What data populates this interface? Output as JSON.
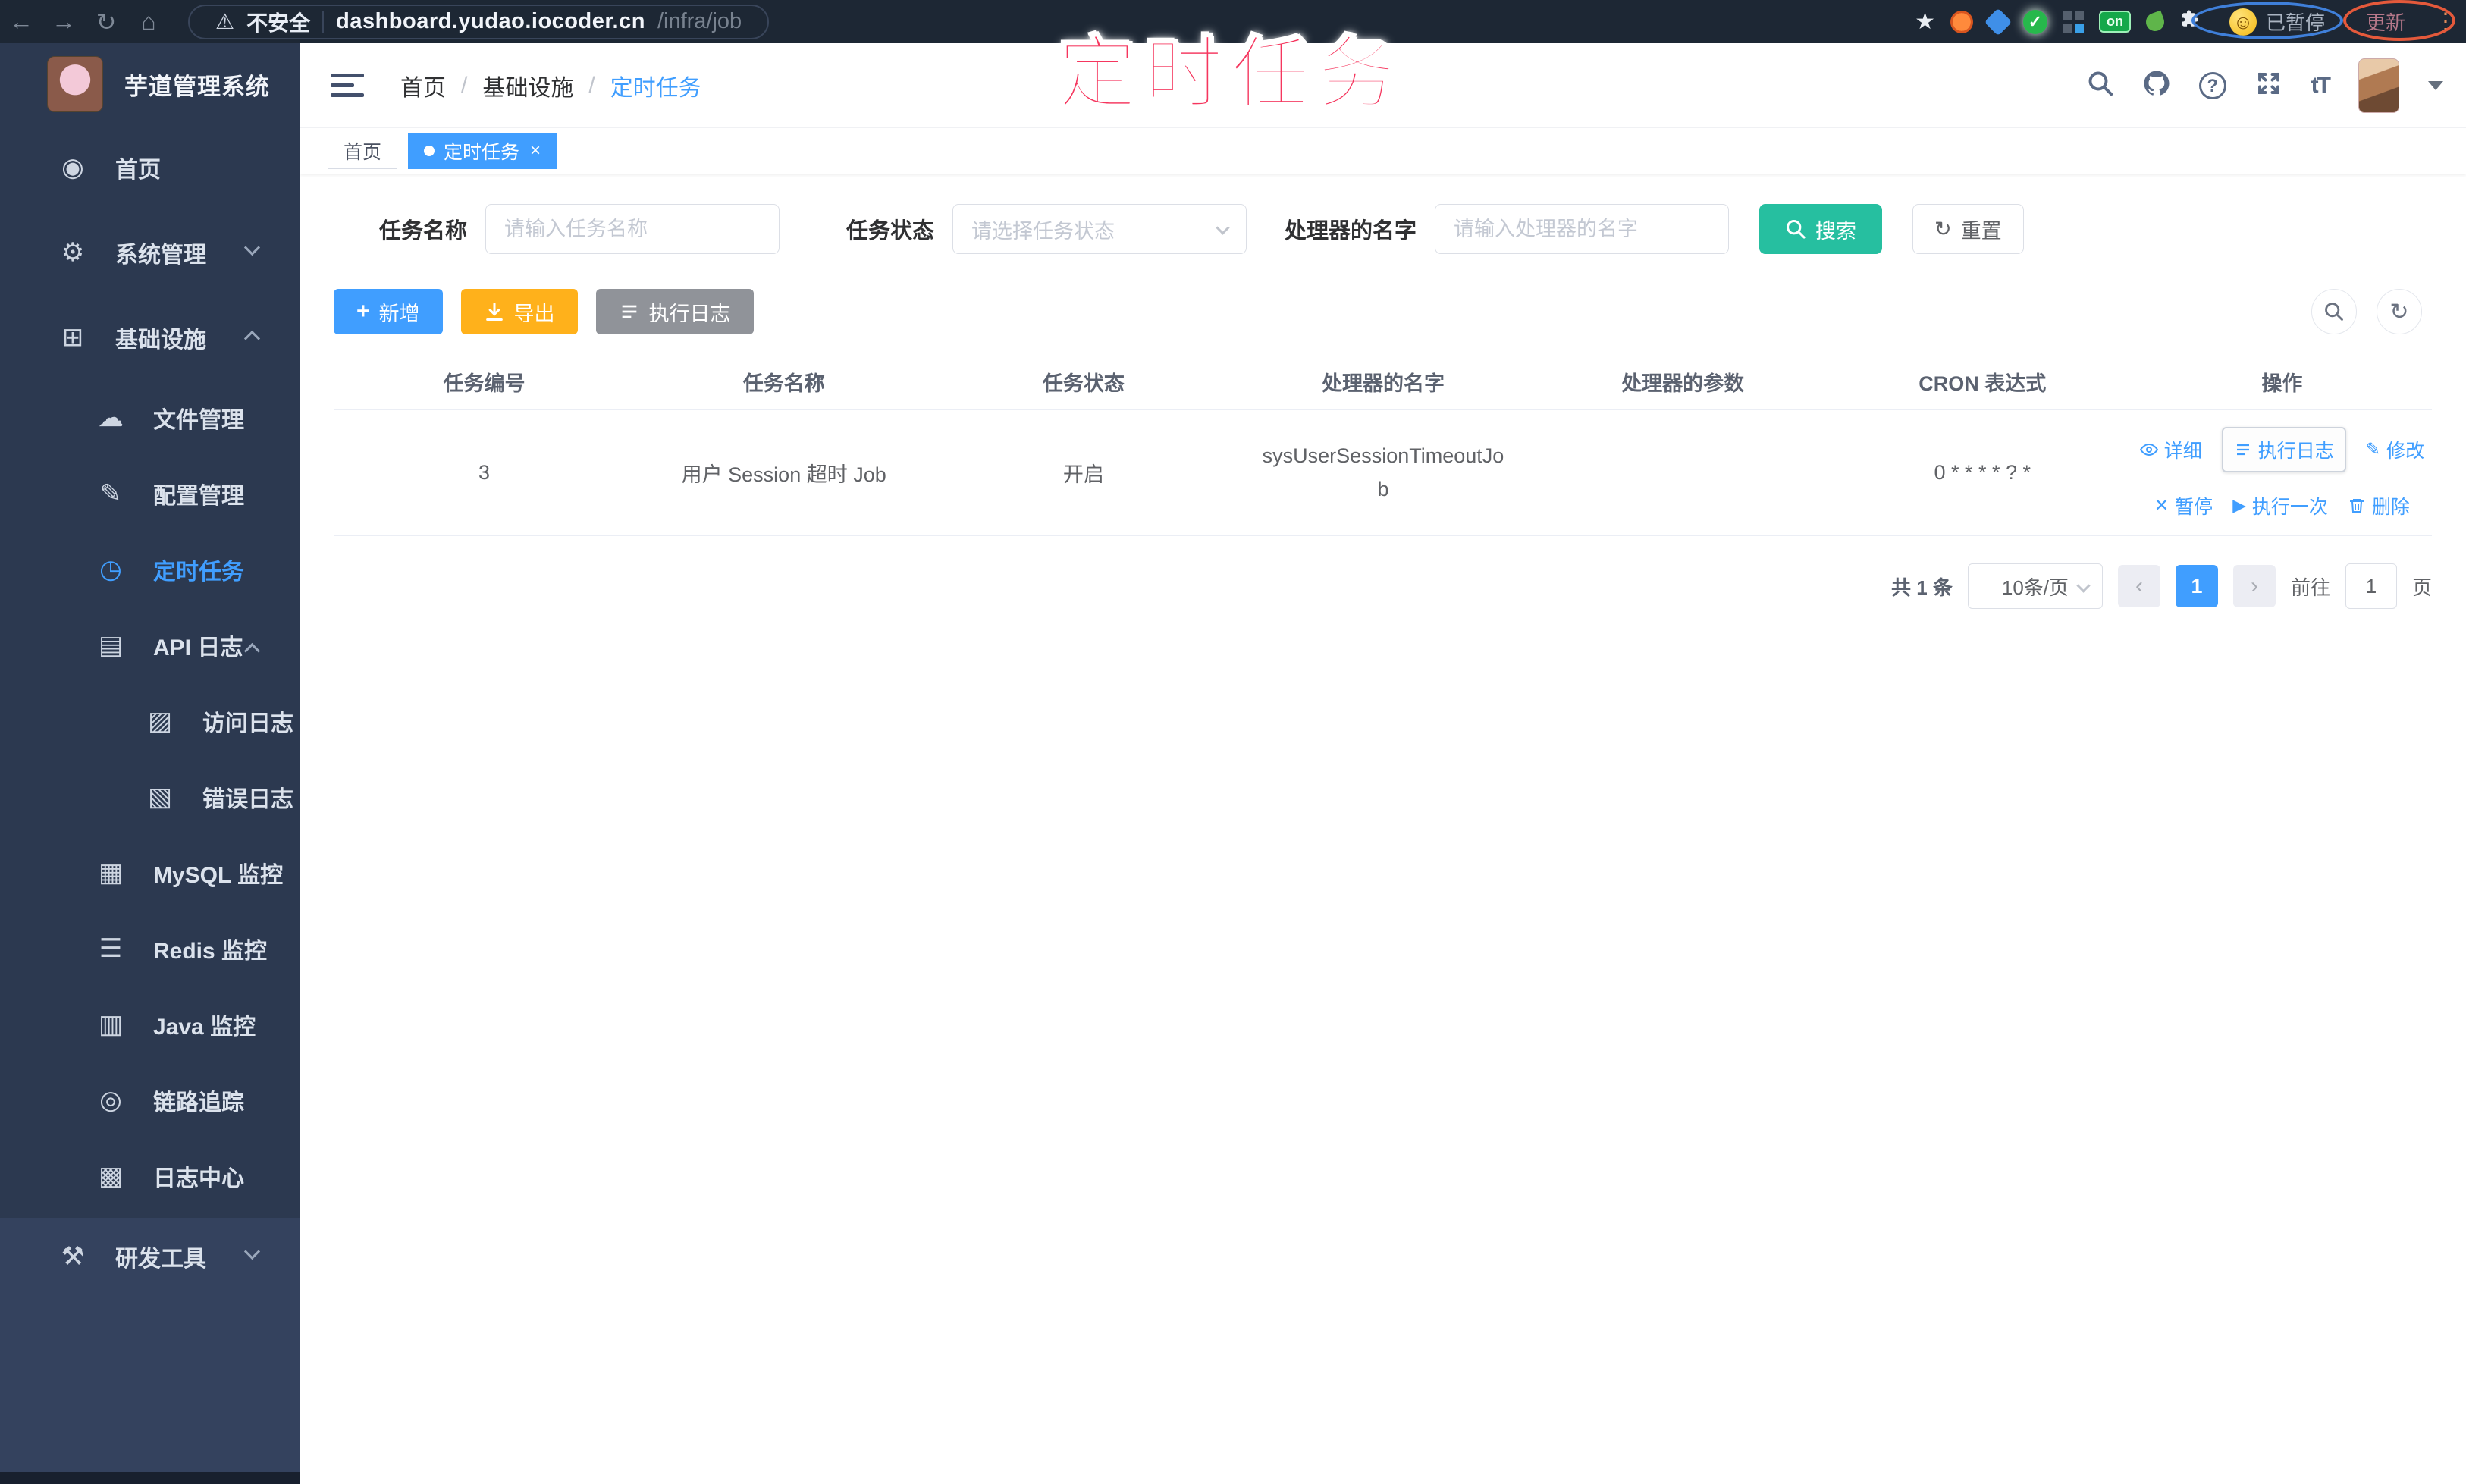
{
  "colors": {
    "primary": "#409eff",
    "search_teal": "#26bfa0",
    "export_orange": "#ffb11b",
    "info_gray": "#909399",
    "sidebar_bg": "#2c3950",
    "annotation_pink": "#f5365e"
  },
  "browser": {
    "security_label": "不安全",
    "url_domain": "dashboard.yudao.iocoder.cn",
    "url_path": "/infra/job",
    "extension_badge": "on",
    "profile_status": "已暂停",
    "update_label": "更新"
  },
  "annotation": {
    "title": "定时任务"
  },
  "sidebar": {
    "logo_title": "芋道管理系统",
    "items": [
      {
        "label": "首页"
      },
      {
        "label": "系统管理"
      },
      {
        "label": "基础设施"
      },
      {
        "label": "文件管理"
      },
      {
        "label": "配置管理"
      },
      {
        "label": "定时任务"
      },
      {
        "label": "API 日志"
      },
      {
        "label": "访问日志"
      },
      {
        "label": "错误日志"
      },
      {
        "label": "MySQL 监控"
      },
      {
        "label": "Redis 监控"
      },
      {
        "label": "Java 监控"
      },
      {
        "label": "链路追踪"
      },
      {
        "label": "日志中心"
      },
      {
        "label": "研发工具"
      }
    ]
  },
  "breadcrumb": {
    "items": [
      "首页",
      "基础设施",
      "定时任务"
    ],
    "separator": "/"
  },
  "tags": {
    "home": "首页",
    "active": "定时任务"
  },
  "filters": {
    "task_name_label": "任务名称",
    "task_name_placeholder": "请输入任务名称",
    "task_status_label": "任务状态",
    "task_status_placeholder": "请选择任务状态",
    "handler_label": "处理器的名字",
    "handler_placeholder": "请输入处理器的名字",
    "search_label": "搜索",
    "reset_label": "重置"
  },
  "toolbar": {
    "add_label": "新增",
    "export_label": "导出",
    "exec_log_label": "执行日志"
  },
  "table": {
    "columns": [
      "任务编号",
      "任务名称",
      "任务状态",
      "处理器的名字",
      "处理器的参数",
      "CRON 表达式",
      "操作"
    ],
    "rows": [
      {
        "id": "3",
        "name": "用户 Session 超时 Job",
        "status": "开启",
        "handler": "sysUserSessionTimeoutJob",
        "params": "",
        "cron": "0 * * * * ? *",
        "actions": [
          "详细",
          "执行日志",
          "修改",
          "暂停",
          "执行一次",
          "删除"
        ]
      }
    ]
  },
  "pagination": {
    "total": "共 1 条",
    "page_size": "10条/页",
    "current_page": "1",
    "goto_label": "前往",
    "goto_value": "1",
    "page_label": "页"
  }
}
